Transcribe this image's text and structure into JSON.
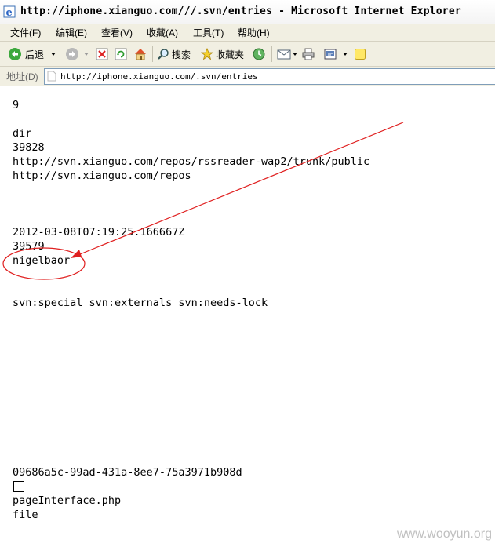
{
  "window": {
    "title": "http://iphone.xianguo.com///.svn/entries - Microsoft Internet Explorer"
  },
  "menu": [
    {
      "label": "文件(F)"
    },
    {
      "label": "编辑(E)"
    },
    {
      "label": "查看(V)"
    },
    {
      "label": "收藏(A)"
    },
    {
      "label": "工具(T)"
    },
    {
      "label": "帮助(H)"
    }
  ],
  "toolbar": {
    "back_label": "后退",
    "search_label": "搜索",
    "favorites_label": "收藏夹"
  },
  "address": {
    "label": "地址(D)",
    "url": "http://iphone.xianguo.com/.svn/entries"
  },
  "entries": [
    "9",
    "dir",
    "39828",
    "http://svn.xianguo.com/repos/rssreader-wap2/trunk/public",
    "http://svn.xianguo.com/repos",
    "2012-03-08T07:19:25.166667Z",
    "39579",
    "nigelbaor",
    "svn:special svn:externals svn:needs-lock",
    "09686a5c-99ad-431a-8ee7-75a3971b908d",
    "pageInterface.php",
    "file"
  ],
  "annotation_color": "#e02020",
  "watermark": "www.wooyun.org"
}
